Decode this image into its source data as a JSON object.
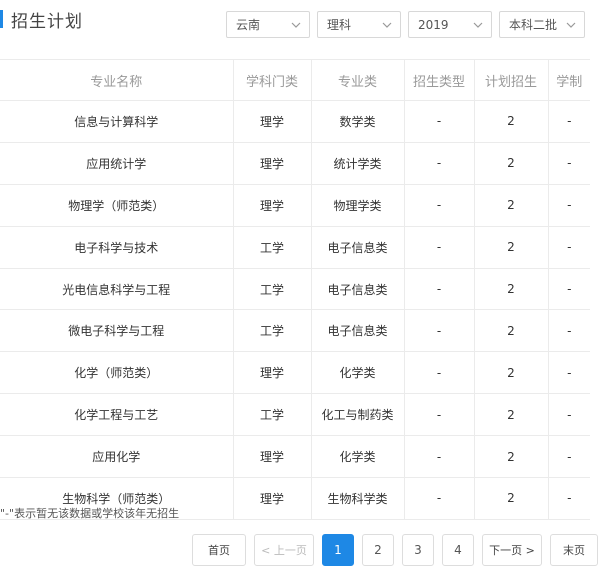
{
  "page": {
    "title": "招生计划",
    "accent_color": "#1e88e5"
  },
  "filters": [
    {
      "value": "云南",
      "icon": "chevron-down-icon"
    },
    {
      "value": "理科",
      "icon": "chevron-down-icon"
    },
    {
      "value": "2019",
      "icon": "chevron-down-icon"
    },
    {
      "value": "本科二批",
      "icon": "chevron-down-icon"
    }
  ],
  "table": {
    "headers": [
      "专业名称",
      "学科门类",
      "专业类",
      "招生类型",
      "计划招生",
      "学制"
    ],
    "rows": [
      [
        "信息与计算科学",
        "理学",
        "数学类",
        "-",
        "2",
        "-"
      ],
      [
        "应用统计学",
        "理学",
        "统计学类",
        "-",
        "2",
        "-"
      ],
      [
        "物理学（师范类）",
        "理学",
        "物理学类",
        "-",
        "2",
        "-"
      ],
      [
        "电子科学与技术",
        "工学",
        "电子信息类",
        "-",
        "2",
        "-"
      ],
      [
        "光电信息科学与工程",
        "工学",
        "电子信息类",
        "-",
        "2",
        "-"
      ],
      [
        "微电子科学与工程",
        "工学",
        "电子信息类",
        "-",
        "2",
        "-"
      ],
      [
        "化学（师范类）",
        "理学",
        "化学类",
        "-",
        "2",
        "-"
      ],
      [
        "化学工程与工艺",
        "工学",
        "化工与制药类",
        "-",
        "2",
        "-"
      ],
      [
        "应用化学",
        "理学",
        "化学类",
        "-",
        "2",
        "-"
      ],
      [
        "生物科学（师范类）",
        "理学",
        "生物科学类",
        "-",
        "2",
        "-"
      ]
    ]
  },
  "note": "\"-\"表示暂无该数据或学校该年无招生",
  "pagination": {
    "first": "首页",
    "prev": "< 上一页",
    "pages": [
      "1",
      "2",
      "3",
      "4"
    ],
    "current": "1",
    "next": "下一页 >",
    "last": "末页"
  }
}
